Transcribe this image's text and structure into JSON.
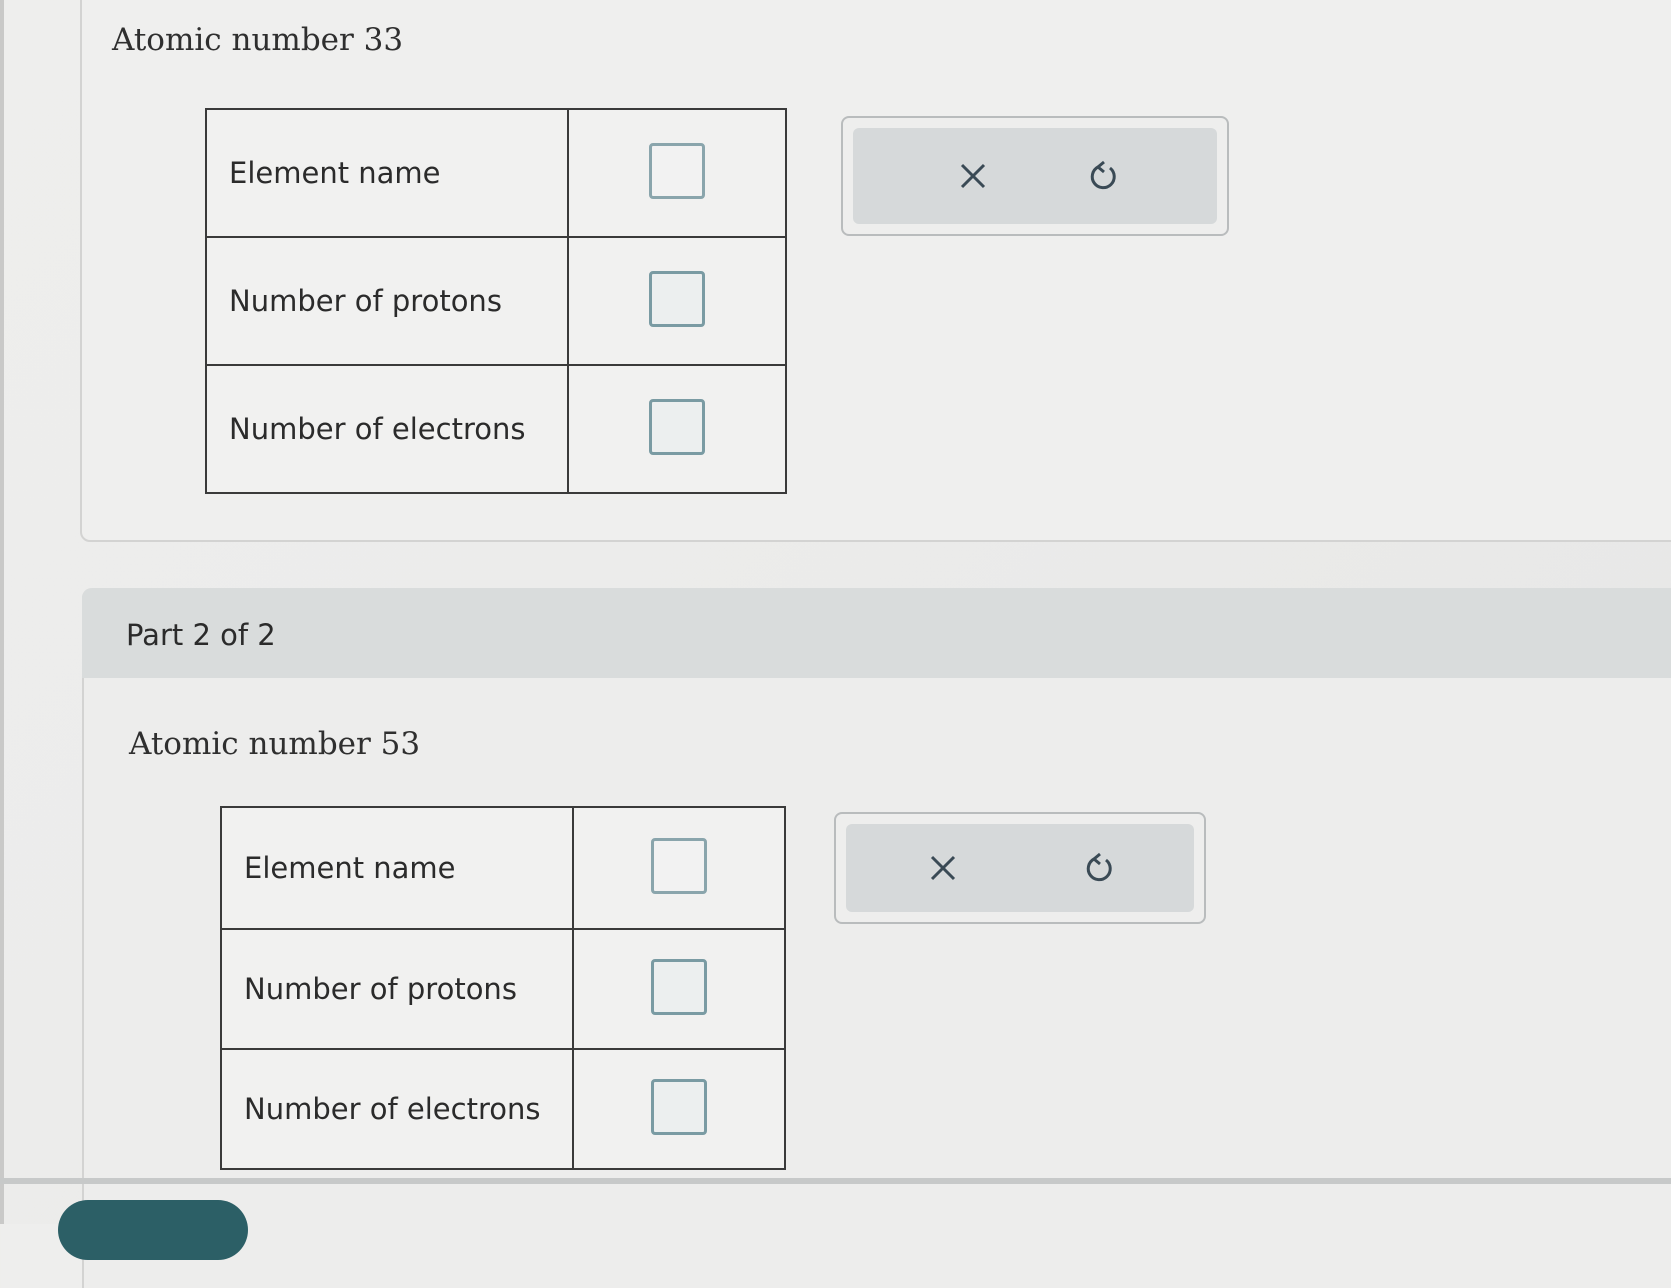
{
  "part1": {
    "title": "Atomic number 33",
    "rows": [
      {
        "label": "Element name"
      },
      {
        "label": "Number of protons"
      },
      {
        "label": "Number of electrons"
      }
    ]
  },
  "part2": {
    "header": "Part 2 of 2",
    "title": "Atomic number 53",
    "rows": [
      {
        "label": "Element name"
      },
      {
        "label": "Number of protons"
      },
      {
        "label": "Number of electrons"
      }
    ]
  },
  "colors": {
    "answer_box_border": "#7a9ba3",
    "toolbar_fill": "#d6d9da",
    "part_header_bg": "#d9dcdc",
    "submit_button": "#2c5f66"
  },
  "icons": {
    "clear": "close-icon",
    "reset": "undo-icon"
  }
}
